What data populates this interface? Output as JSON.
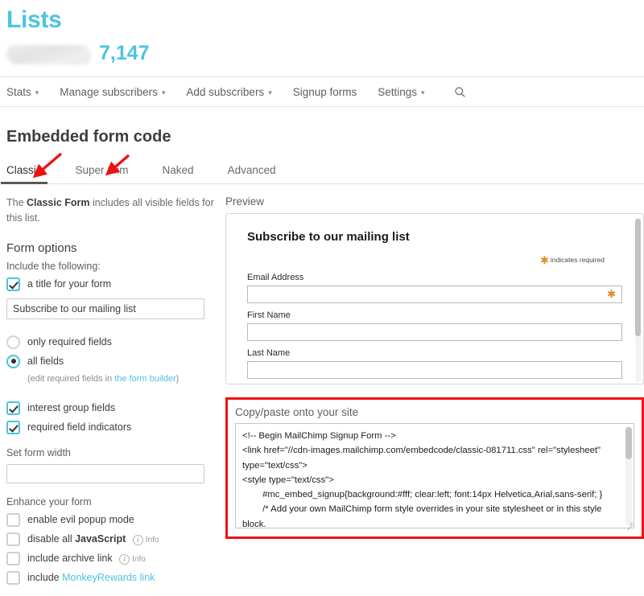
{
  "header": {
    "title": "Lists",
    "subscriber_count": "7,147",
    "list_name_redacted": ""
  },
  "nav": {
    "items": [
      {
        "label": "Stats",
        "has_caret": true
      },
      {
        "label": "Manage subscribers",
        "has_caret": true
      },
      {
        "label": "Add subscribers",
        "has_caret": true
      },
      {
        "label": "Signup forms",
        "has_caret": false
      },
      {
        "label": "Settings",
        "has_caret": true
      }
    ],
    "search_icon": "search-icon"
  },
  "page": {
    "title": "Embedded form code",
    "tabs": [
      {
        "label": "Classic",
        "active": true
      },
      {
        "label": "Super Slim",
        "active": false
      },
      {
        "label": "Naked",
        "active": false
      },
      {
        "label": "Advanced",
        "active": false
      }
    ]
  },
  "left": {
    "intro_pre": "The ",
    "intro_bold": "Classic Form",
    "intro_post": " includes all visible fields for this list.",
    "form_options_heading": "Form options",
    "include_label": "Include the following:",
    "title_checkbox_label": "a title for your form",
    "title_value": "Subscribe to our mailing list",
    "radio_only_required": "only required fields",
    "radio_all_fields": "all fields",
    "edit_note_pre": "(edit required fields in ",
    "edit_note_link": "the form builder",
    "edit_note_post": ")",
    "interest_group_label": "interest group fields",
    "required_indicators_label": "required field indicators",
    "set_width_label": "Set form width",
    "set_width_value": "",
    "enhance_heading": "Enhance your form",
    "enhance_items": [
      {
        "label": "enable evil popup mode",
        "bold": "",
        "info": false,
        "link": ""
      },
      {
        "label": "disable all ",
        "bold": "JavaScript",
        "info": true,
        "link": ""
      },
      {
        "label": "include archive link",
        "bold": "",
        "info": true,
        "link": ""
      },
      {
        "label": "include ",
        "bold": "",
        "info": false,
        "link": "MonkeyRewards link"
      }
    ],
    "info_text": "Info"
  },
  "preview": {
    "label": "Preview",
    "form_title": "Subscribe to our mailing list",
    "required_note": "indicates required",
    "fields": [
      {
        "label": "Email Address",
        "required": true
      },
      {
        "label": "First Name",
        "required": false
      },
      {
        "label": "Last Name",
        "required": false
      }
    ]
  },
  "code": {
    "label": "Copy/paste onto your site",
    "value": "<!-- Begin MailChimp Signup Form -->\n<link href=\"//cdn-images.mailchimp.com/embedcode/classic-081711.css\" rel=\"stylesheet\" type=\"text/css\">\n<style type=\"text/css\">\n\t#mc_embed_signup{background:#fff; clear:left; font:14px Helvetica,Arial,sans-serif; }\n\t/* Add your own MailChimp form style overrides in your site stylesheet or in this style block.\n\t   We recommend moving this block and the preceding CSS link to the HEAD of your HTML file. */\n</style>"
  },
  "colors": {
    "brand_cyan": "#4cc3e0",
    "annotation_red": "#ee1111",
    "required_orange": "#e08b1e",
    "text_dark": "#3d3d3d"
  },
  "annotations": {
    "arrow_classic": "red-arrow-pointing-to-classic-tab",
    "arrow_super_slim": "red-arrow-pointing-to-super-slim-tab",
    "code_highlight_box": "red-rectangle-around-copy-paste-code"
  }
}
